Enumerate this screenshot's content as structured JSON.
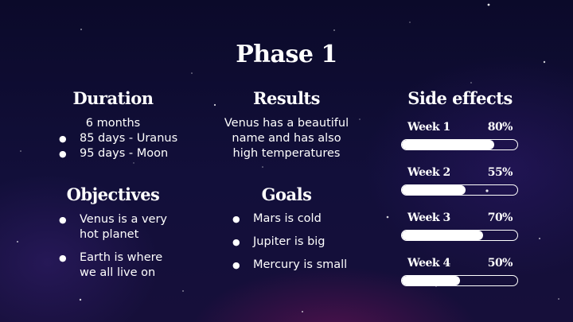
{
  "title": "Phase 1",
  "duration": {
    "heading": "Duration",
    "lead": "6 months",
    "items": [
      "85 days - Uranus",
      "95 days - Moon"
    ]
  },
  "objectives": {
    "heading": "Objectives",
    "items": [
      "Venus is a very hot planet",
      "Earth is where we all live on"
    ]
  },
  "results": {
    "heading": "Results",
    "text": "Venus has a beautiful name and has also high temperatures"
  },
  "goals": {
    "heading": "Goals",
    "items": [
      "Mars is cold",
      "Jupiter is big",
      "Mercury is small"
    ]
  },
  "side_effects": {
    "heading": "Side effects",
    "weeks": [
      {
        "label": "Week 1",
        "percent_text": "80%",
        "level": 0.8
      },
      {
        "label": "Week 2",
        "percent_text": "55%",
        "level": 0.55
      },
      {
        "label": "Week 3",
        "percent_text": "70%",
        "level": 0.7
      },
      {
        "label": "Week 4",
        "percent_text": "50%",
        "level": 0.5
      }
    ]
  },
  "colors": {
    "background": "#0f0d33",
    "text": "#ffffff",
    "bar_fill": "#ffffff"
  }
}
